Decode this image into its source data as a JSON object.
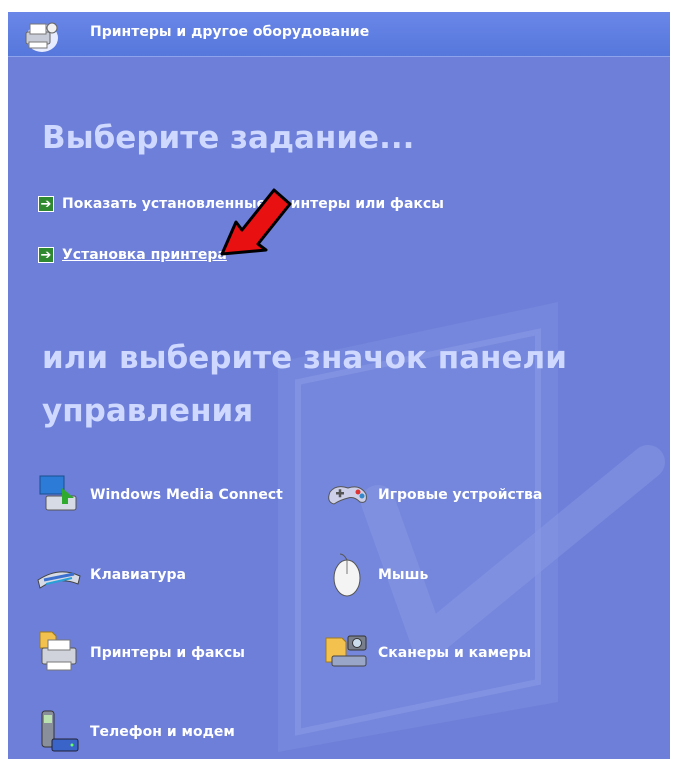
{
  "header": {
    "title": "Принтеры и другое оборудование"
  },
  "main": {
    "pick_task_heading": "Выберите задание...",
    "tasks": [
      {
        "label": "Показать установленные принтеры или факсы"
      },
      {
        "label": "Установка принтера"
      }
    ],
    "or_pick_heading": "или выберите значок панели управления",
    "control_panel_icons": [
      {
        "label": "Windows Media Connect",
        "icon": "media-connect-icon"
      },
      {
        "label": "Игровые устройства",
        "icon": "gamepad-icon"
      },
      {
        "label": "Клавиатура",
        "icon": "keyboard-icon"
      },
      {
        "label": "Мышь",
        "icon": "mouse-icon"
      },
      {
        "label": "Принтеры и факсы",
        "icon": "printer-fax-icon"
      },
      {
        "label": "Сканеры и камеры",
        "icon": "scanner-camera-icon"
      },
      {
        "label": "Телефон и модем",
        "icon": "phone-modem-icon"
      }
    ]
  },
  "colors": {
    "panel_bg": "#6d7fd8",
    "heading": "#cfd8ff",
    "annotation_arrow": "#e81010"
  }
}
